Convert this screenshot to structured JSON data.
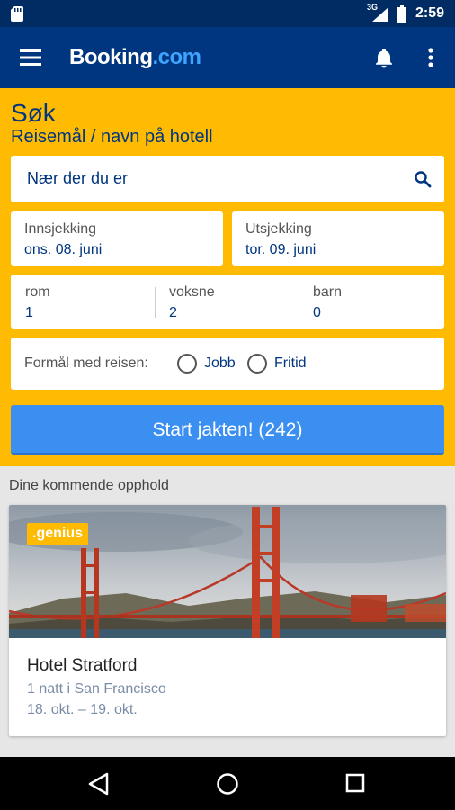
{
  "status_bar": {
    "network": "3G",
    "time": "2:59"
  },
  "app_bar": {
    "logo_main": "Booking",
    "logo_suffix": ".com"
  },
  "search": {
    "title": "Søk",
    "subtitle": "Reisemål / navn på hotell",
    "destination_value": "Nær der du er",
    "checkin_label": "Innsjekking",
    "checkin_value": "ons. 08. juni",
    "checkout_label": "Utsjekking",
    "checkout_value": "tor. 09. juni",
    "rooms_label": "rom",
    "rooms_value": "1",
    "adults_label": "voksne",
    "adults_value": "2",
    "children_label": "barn",
    "children_value": "0",
    "purpose_label": "Formål med reisen:",
    "purpose_options": [
      "Jobb",
      "Fritid"
    ],
    "cta_label": "Start jakten! (242)"
  },
  "upcoming": {
    "title": "Dine kommende opphold",
    "badge": ".genius",
    "hotel_name": "Hotel Stratford",
    "nights": "1 natt i San Francisco",
    "dates": "18. okt. – 19. okt."
  },
  "colors": {
    "brand_dark": "#003580",
    "brand_yellow": "#febb02",
    "cta_blue": "#3b8ff0"
  },
  "icons": [
    "sd-card-icon",
    "signal-icon",
    "battery-icon",
    "menu-icon",
    "bell-icon",
    "more-vert-icon",
    "search-icon",
    "back-icon",
    "home-icon",
    "recents-icon"
  ]
}
